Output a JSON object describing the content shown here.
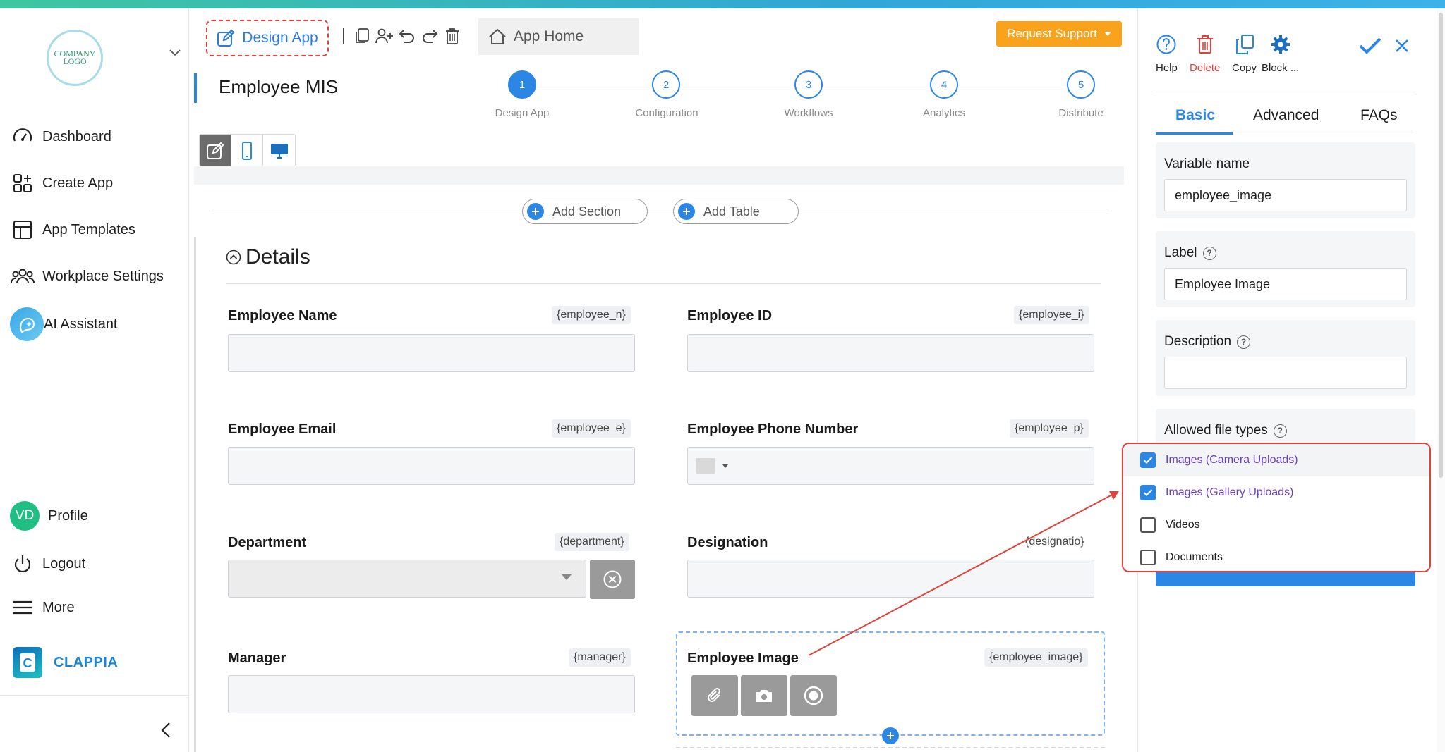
{
  "colors": {
    "accent": "#2b86e4",
    "danger": "#e0413a",
    "support": "#f9a21b",
    "checked_text": "#6a3fbf"
  },
  "sidebar": {
    "logo_text": "COMPANY LOGO",
    "items": [
      {
        "label": "Dashboard",
        "icon": "speedometer-icon"
      },
      {
        "label": "Create App",
        "icon": "grid-plus-icon"
      },
      {
        "label": "App Templates",
        "icon": "template-icon"
      },
      {
        "label": "Workplace Settings",
        "icon": "users-icon"
      },
      {
        "label": "AI Assistant",
        "icon": "ai-sparkle-icon"
      }
    ],
    "profile": {
      "initials": "VD",
      "label": "Profile"
    },
    "logout": "Logout",
    "more": "More",
    "brand": "CLAPPIA",
    "brand_logo_letter": "C"
  },
  "header": {
    "design_app": "Design App",
    "app_home": "App Home",
    "request_support": "Request Support",
    "app_title": "Employee MIS"
  },
  "stepper": [
    {
      "num": "1",
      "label": "Design App"
    },
    {
      "num": "2",
      "label": "Configuration"
    },
    {
      "num": "3",
      "label": "Workflows"
    },
    {
      "num": "4",
      "label": "Analytics"
    },
    {
      "num": "5",
      "label": "Distribute"
    }
  ],
  "canvas": {
    "add_section": "Add Section",
    "add_table": "Add Table",
    "section_title": "Details",
    "fields": [
      {
        "label": "Employee Name",
        "var": "{employee_n}"
      },
      {
        "label": "Employee ID",
        "var": "{employee_i}"
      },
      {
        "label": "Employee Email",
        "var": "{employee_e}"
      },
      {
        "label": "Employee Phone Number",
        "var": "{employee_p}"
      },
      {
        "label": "Department",
        "var": "{department}"
      },
      {
        "label": "Designation",
        "var": "{designatio}"
      },
      {
        "label": "Manager",
        "var": "{manager}"
      },
      {
        "label": "Employee Image",
        "var": "{employee_image}"
      }
    ]
  },
  "panel": {
    "actions": {
      "help": "Help",
      "delete": "Delete",
      "copy": "Copy",
      "block": "Block ..."
    },
    "tabs": [
      "Basic",
      "Advanced",
      "FAQs"
    ],
    "variable_name": {
      "label": "Variable name",
      "value": "employee_image"
    },
    "label": {
      "label": "Label",
      "value": "Employee Image"
    },
    "description": {
      "label": "Description",
      "value": ""
    },
    "allowed_file_types": {
      "label": "Allowed file types",
      "options": [
        {
          "label": "Images (Camera Uploads)",
          "checked": true
        },
        {
          "label": "Images (Gallery Uploads)",
          "checked": true
        },
        {
          "label": "Videos",
          "checked": false
        },
        {
          "label": "Documents",
          "checked": false
        }
      ]
    },
    "help_glyph": "?"
  }
}
